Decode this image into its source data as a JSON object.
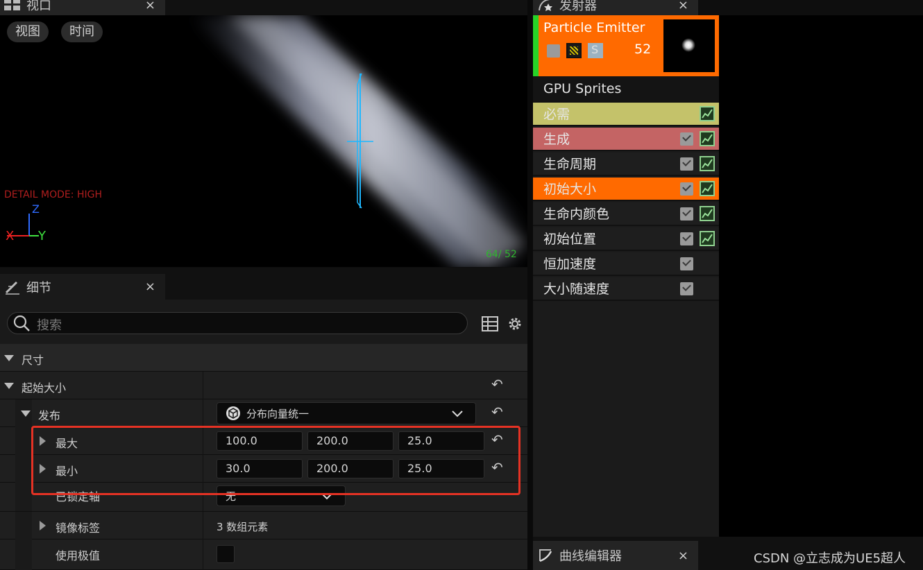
{
  "viewport_tab": {
    "title": "视口",
    "close": "×"
  },
  "viewport": {
    "view_btn": "视图",
    "time_btn": "时间",
    "detail_mode": "DETAIL MODE: HIGH",
    "axis_z": "Z",
    "axis_x": "X",
    "axis_y": "Y",
    "counter": "64/ 52"
  },
  "details_tab": {
    "title": "细节",
    "close": "×"
  },
  "details": {
    "search_placeholder": "搜索",
    "section_size": "尺寸",
    "start_size": "起始大小",
    "distribution": {
      "label": "发布",
      "value": "分布向量统一"
    },
    "max": {
      "label": "最大",
      "x": "100.0",
      "y": "200.0",
      "z": "25.0"
    },
    "min": {
      "label": "最小",
      "x": "30.0",
      "y": "200.0",
      "z": "25.0"
    },
    "locked_axes": {
      "label": "已锁定轴",
      "value": "无"
    },
    "mirror_flags": {
      "label": "镜像标签",
      "value": "3 数组元素"
    },
    "use_extremes": {
      "label": "使用极值"
    }
  },
  "emitter_tab": {
    "title": "发射器",
    "close": "×"
  },
  "emitter": {
    "name": "Particle Emitter",
    "count": "52",
    "solo_label": "S",
    "type": "GPU Sprites",
    "modules": [
      {
        "label": "必需",
        "color": "#c4c26a",
        "check": false,
        "curve": true
      },
      {
        "label": "生成",
        "color": "#c46464",
        "check": true,
        "curve": true
      },
      {
        "label": "生命周期",
        "color": "#1e1e1e",
        "check": true,
        "curve": true
      },
      {
        "label": "初始大小",
        "color": "#ff6a00",
        "check": true,
        "curve": true
      },
      {
        "label": "生命内颜色",
        "color": "#1e1e1e",
        "check": true,
        "curve": true
      },
      {
        "label": "初始位置",
        "color": "#1e1e1e",
        "check": true,
        "curve": true
      },
      {
        "label": "恒加速度",
        "color": "#1e1e1e",
        "check": true,
        "curve": false
      },
      {
        "label": "大小随速度",
        "color": "#1e1e1e",
        "check": true,
        "curve": false
      }
    ]
  },
  "curve_tab": {
    "title": "曲线编辑器",
    "close": "×"
  },
  "watermark": "CSDN @立志成为UE5超人",
  "colors": {
    "accent_orange": "#ff6a00",
    "annotation_red": "#e53224",
    "wire_cyan": "#1fb8ff"
  }
}
